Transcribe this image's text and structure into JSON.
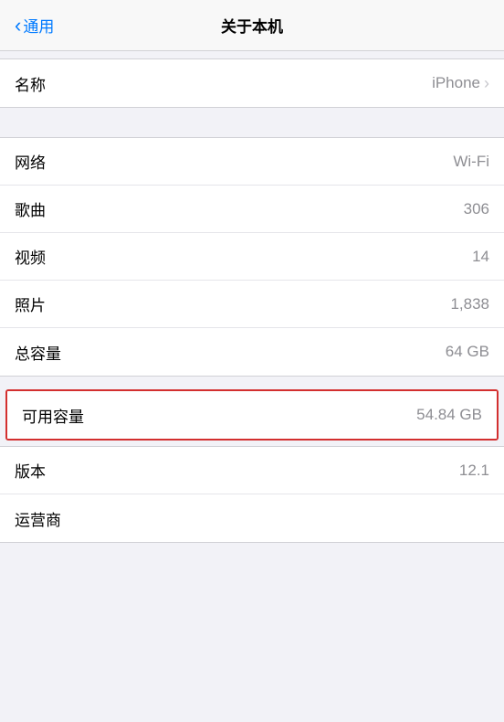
{
  "nav": {
    "back_label": "通用",
    "title": "关于本机"
  },
  "sections": [
    {
      "id": "name-section",
      "rows": [
        {
          "id": "name",
          "label": "名称",
          "value": "iPhone",
          "has_chevron": true
        }
      ]
    },
    {
      "id": "info-section",
      "rows": [
        {
          "id": "network",
          "label": "网络",
          "value": "Wi-Fi",
          "has_chevron": false
        },
        {
          "id": "songs",
          "label": "歌曲",
          "value": "306",
          "has_chevron": false
        },
        {
          "id": "videos",
          "label": "视频",
          "value": "14",
          "has_chevron": false
        },
        {
          "id": "photos",
          "label": "照片",
          "value": "1,838",
          "has_chevron": false
        },
        {
          "id": "total-capacity",
          "label": "总容量",
          "value": "64 GB",
          "has_chevron": false
        }
      ]
    },
    {
      "id": "available-section",
      "rows": [
        {
          "id": "available-capacity",
          "label": "可用容量",
          "value": "54.84 GB",
          "has_chevron": false,
          "highlighted": true
        }
      ]
    },
    {
      "id": "version-section",
      "rows": [
        {
          "id": "version",
          "label": "版本",
          "value": "12.1",
          "has_chevron": false
        },
        {
          "id": "carrier",
          "label": "运营商",
          "value": "",
          "has_chevron": false
        }
      ]
    }
  ],
  "chevron_symbol": "›",
  "colors": {
    "highlight_border": "#d32f2f",
    "accent": "#007aff",
    "label": "#000000",
    "value": "#8e8e93",
    "background": "#f2f2f7",
    "section_bg": "#ffffff",
    "separator": "#d1d1d6"
  }
}
